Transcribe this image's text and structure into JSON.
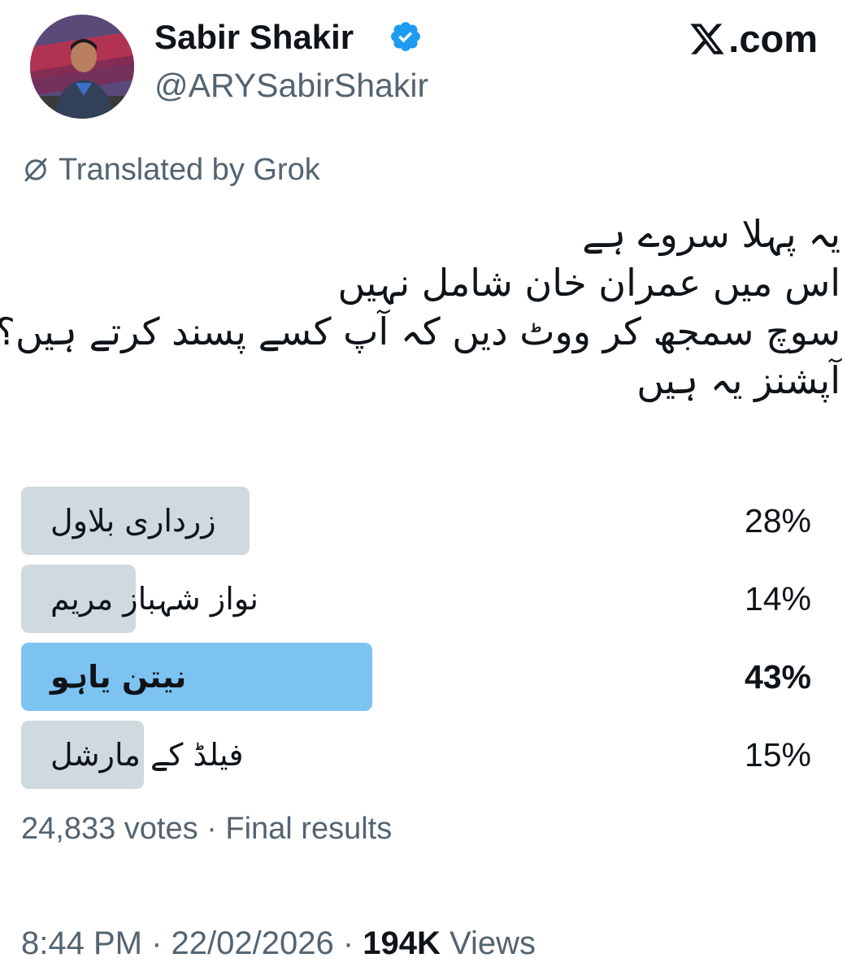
{
  "author": {
    "display_name": "Sabir Shakir",
    "handle": "@ARYSabirShakir",
    "verified_icon": "verified-badge-icon"
  },
  "site": {
    "label": ".com",
    "logo_icon": "x-logo-icon"
  },
  "translation": {
    "icon": "grok-icon",
    "label": "Translated by Grok"
  },
  "tweet": {
    "lines": [
      "یہ پہلا سروے ہے",
      "اس میں عمران خان شامل نہیں",
      "سوچ سمجھ کر ووٹ دیں کہ آپ کسے پسند کرتے ہیں؟",
      "آپشنز یہ ہیں"
    ]
  },
  "poll": {
    "options": [
      {
        "label": "زرداری بلاول",
        "percent_text": "28%",
        "percent": 28,
        "winner": false
      },
      {
        "label": "نواز شہباز مریم",
        "percent_text": "14%",
        "percent": 14,
        "winner": false
      },
      {
        "label": "نیتن یاہو",
        "percent_text": "43%",
        "percent": 43,
        "winner": true
      },
      {
        "label": "فیلڈ کے مارشل",
        "percent_text": "15%",
        "percent": 15,
        "winner": false
      }
    ],
    "footer": "24,833 votes · Final results"
  },
  "meta": {
    "timestamp": "8:44 PM · 22/02/2026 · ",
    "views_count": "194K",
    "views_label": " Views"
  },
  "colors": {
    "text_primary": "#0f1419",
    "text_secondary": "#536471",
    "poll_bar": "#cfd9de",
    "poll_bar_winner": "#7cc3f2",
    "verified_blue": "#1d9bf0"
  }
}
